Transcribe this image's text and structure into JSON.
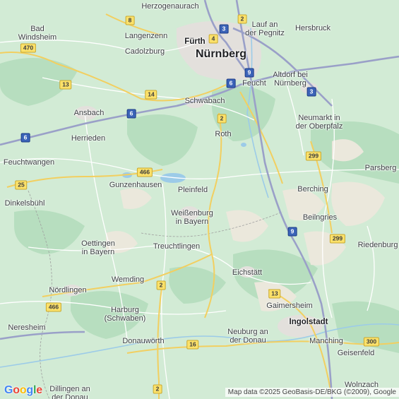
{
  "places": [
    {
      "id": "herzogenaurach",
      "text": "Herzogenaurach"
    },
    {
      "id": "lauf",
      "text": "Lauf an\nder Pegnitz"
    },
    {
      "id": "hersbruck",
      "text": "Hersbruck"
    },
    {
      "id": "bad-windsheim",
      "text": "Bad\nWindsheim"
    },
    {
      "id": "langenzenn",
      "text": "Langenzenn"
    },
    {
      "id": "furth",
      "text": "Fürth"
    },
    {
      "id": "nurnberg",
      "text": "Nürnberg"
    },
    {
      "id": "cadolzburg",
      "text": "Cadolzburg"
    },
    {
      "id": "feucht",
      "text": "Feucht"
    },
    {
      "id": "altdorf",
      "text": "Altdorf bei\nNürnberg"
    },
    {
      "id": "schwabach",
      "text": "Schwabach"
    },
    {
      "id": "ansbach",
      "text": "Ansbach"
    },
    {
      "id": "neumarkt",
      "text": "Neumarkt in\nder Oberpfalz"
    },
    {
      "id": "herrieden",
      "text": "Herrieden"
    },
    {
      "id": "roth",
      "text": "Roth"
    },
    {
      "id": "feuchtwangen",
      "text": "Feuchtwangen"
    },
    {
      "id": "parsberg",
      "text": "Parsberg"
    },
    {
      "id": "gunzenhausen",
      "text": "Gunzenhausen"
    },
    {
      "id": "pleinfeld",
      "text": "Pleinfeld"
    },
    {
      "id": "berching",
      "text": "Berching"
    },
    {
      "id": "dinkelsbuhl",
      "text": "Dinkelsbühl"
    },
    {
      "id": "weissenburg",
      "text": "Weißenburg\nin Bayern"
    },
    {
      "id": "beilngries",
      "text": "Beilngries"
    },
    {
      "id": "oettingen",
      "text": "Oettingen\nin Bayern"
    },
    {
      "id": "treuchtlingen",
      "text": "Treuchtlingen"
    },
    {
      "id": "riedenburg",
      "text": "Riedenburg"
    },
    {
      "id": "eichstatt",
      "text": "Eichstätt"
    },
    {
      "id": "wemding",
      "text": "Wemding"
    },
    {
      "id": "nordlingen",
      "text": "Nördlingen"
    },
    {
      "id": "gaimersheim",
      "text": "Gaimersheim"
    },
    {
      "id": "harburg",
      "text": "Harburg\n(Schwaben)"
    },
    {
      "id": "ingolstadt",
      "text": "Ingolstadt"
    },
    {
      "id": "neresheim",
      "text": "Neresheim"
    },
    {
      "id": "neuburg",
      "text": "Neuburg an\nder Donau"
    },
    {
      "id": "donauworth",
      "text": "Donauwörth"
    },
    {
      "id": "manching",
      "text": "Manching"
    },
    {
      "id": "geisenfeld",
      "text": "Geisenfeld"
    },
    {
      "id": "dillingen",
      "text": "Dillingen an\nder Donau"
    },
    {
      "id": "wolnzach",
      "text": "Wolnzach"
    }
  ],
  "shields": [
    {
      "id": "s8",
      "text": "8",
      "kind": "yel"
    },
    {
      "id": "s2a",
      "text": "2",
      "kind": "yel"
    },
    {
      "id": "s3a",
      "text": "3",
      "kind": "blue"
    },
    {
      "id": "s4",
      "text": "4",
      "kind": "yel"
    },
    {
      "id": "s470",
      "text": "470",
      "kind": "yel"
    },
    {
      "id": "s9a",
      "text": "9",
      "kind": "blue"
    },
    {
      "id": "s6a",
      "text": "6",
      "kind": "blue"
    },
    {
      "id": "s13a",
      "text": "13",
      "kind": "yel"
    },
    {
      "id": "s3b",
      "text": "3",
      "kind": "blue"
    },
    {
      "id": "s14",
      "text": "14",
      "kind": "yel"
    },
    {
      "id": "s6b",
      "text": "6",
      "kind": "blue"
    },
    {
      "id": "s2b",
      "text": "2",
      "kind": "yel"
    },
    {
      "id": "s6c",
      "text": "6",
      "kind": "blue"
    },
    {
      "id": "s299a",
      "text": "299",
      "kind": "yel"
    },
    {
      "id": "s466a",
      "text": "466",
      "kind": "yel"
    },
    {
      "id": "s25",
      "text": "25",
      "kind": "yel"
    },
    {
      "id": "s9b",
      "text": "9",
      "kind": "blue"
    },
    {
      "id": "s299b",
      "text": "299",
      "kind": "yel"
    },
    {
      "id": "s2c",
      "text": "2",
      "kind": "yel"
    },
    {
      "id": "s13b",
      "text": "13",
      "kind": "yel"
    },
    {
      "id": "s466b",
      "text": "466",
      "kind": "yel"
    },
    {
      "id": "s16",
      "text": "16",
      "kind": "yel"
    },
    {
      "id": "s300",
      "text": "300",
      "kind": "yel"
    },
    {
      "id": "s2d",
      "text": "2",
      "kind": "yel"
    }
  ],
  "footer": {
    "logo": "Google",
    "attribution": "Map data ©2025 GeoBasis-DE/BKG (©2009), Google"
  },
  "colors": {
    "land": "#cfe9d2",
    "forest": "#b4dcbc",
    "open_land": "#ece9df",
    "urban": "#e6e3df",
    "water": "#9ccbe8",
    "motorway": "#9aa0c8",
    "primary_road": "#f2cf60",
    "minor_road": "#ffffff",
    "border": "#9e9e9e"
  }
}
